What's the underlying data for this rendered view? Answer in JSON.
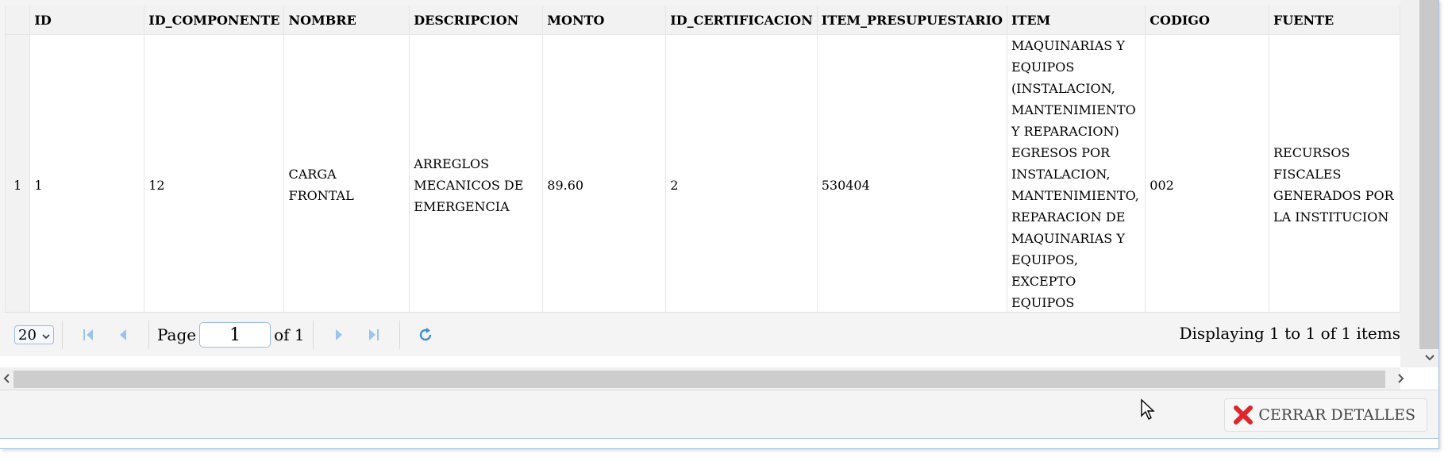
{
  "grid": {
    "columns": [
      "ID",
      "ID_COMPONENTE",
      "NOMBRE",
      "DESCRIPCION",
      "MONTO",
      "ID_CERTIFICACION",
      "ITEM_PRESUPUESTARIO",
      "ITEM",
      "CODIGO",
      "FUENTE"
    ],
    "rows": [
      {
        "rownum": "1",
        "cells": [
          "1",
          "12",
          "CARGA FRONTAL",
          "ARREGLOS MECANICOS DE EMERGENCIA",
          "89.60",
          "2",
          "530404",
          "MAQUINARIAS Y EQUIPOS (INSTALACION, MANTENIMIENTO Y REPARACION) EGRESOS POR INSTALACION, MANTENIMIENTO, REPARACION DE MAQUINARIAS Y EQUIPOS, EXCEPTO EQUIPOS INFORMATICOS.",
          "002",
          "RECURSOS FISCALES GENERADOS POR LA INSTITUCION"
        ]
      }
    ]
  },
  "pager": {
    "page_size": "20",
    "page_label": "Page",
    "page_value": "1",
    "of_label": "of 1",
    "display_text": "Displaying 1 to 1 of 1 items"
  },
  "footer": {
    "close_label": "CERRAR DETALLES"
  },
  "colors": {
    "accent_blue": "#6ba7e0",
    "close_red": "#e0242a"
  }
}
